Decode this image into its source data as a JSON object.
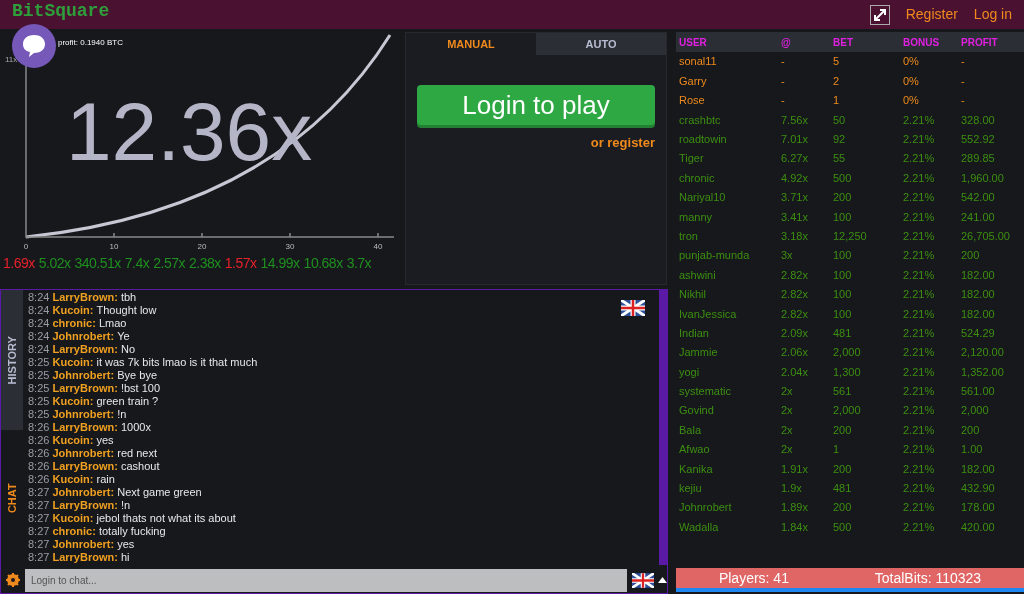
{
  "header": {
    "logo": "BitSquare",
    "links": [
      {
        "label": "Register"
      },
      {
        "label": "Log in"
      }
    ]
  },
  "game": {
    "profit_label": "profit: 0.1940 BTC",
    "y_tick": "11x",
    "x_ticks": [
      "0",
      "10",
      "20",
      "30",
      "40"
    ],
    "multiplier": "12.36x"
  },
  "history": [
    {
      "value": "1.69x",
      "color": "#e8202a"
    },
    {
      "value": "5.02x",
      "color": "#1f8f1f"
    },
    {
      "value": "340.51x",
      "color": "#1f8f1f"
    },
    {
      "value": "7.4x",
      "color": "#1f8f1f"
    },
    {
      "value": "2.57x",
      "color": "#1f8f1f"
    },
    {
      "value": "2.38x",
      "color": "#1f8f1f"
    },
    {
      "value": "1.57x",
      "color": "#e8202a"
    },
    {
      "value": "14.99x",
      "color": "#1f8f1f"
    },
    {
      "value": "10.68x",
      "color": "#1f8f1f"
    },
    {
      "value": "3.7x",
      "color": "#1f8f1f"
    }
  ],
  "controls": {
    "tabs": [
      {
        "label": "MANUAL",
        "selected": true
      },
      {
        "label": "AUTO",
        "selected": false
      }
    ],
    "play_button": "Login to play",
    "register_link": "or register"
  },
  "chat": {
    "side_tabs": [
      {
        "label": "HISTORY",
        "selected": false
      },
      {
        "label": "CHAT",
        "selected": true
      }
    ],
    "messages": [
      {
        "time": "8:24",
        "user": "LarryBrown:",
        "text": "tbh"
      },
      {
        "time": "8:24",
        "user": "Kucoin:",
        "text": "Thought low"
      },
      {
        "time": "8:24",
        "user": "chronic:",
        "text": "Lmao"
      },
      {
        "time": "8:24",
        "user": "Johnrobert:",
        "text": "Ye"
      },
      {
        "time": "8:24",
        "user": "LarryBrown:",
        "text": "No"
      },
      {
        "time": "8:25",
        "user": "Kucoin:",
        "text": "it was 7k bits lmao is it that much"
      },
      {
        "time": "8:25",
        "user": "Johnrobert:",
        "text": "Bye bye"
      },
      {
        "time": "8:25",
        "user": "LarryBrown:",
        "text": "!bst 100"
      },
      {
        "time": "8:25",
        "user": "Kucoin:",
        "text": "green train ?"
      },
      {
        "time": "8:25",
        "user": "Johnrobert:",
        "text": "!n"
      },
      {
        "time": "8:26",
        "user": "LarryBrown:",
        "text": "1000x"
      },
      {
        "time": "8:26",
        "user": "Kucoin:",
        "text": "yes"
      },
      {
        "time": "8:26",
        "user": "Johnrobert:",
        "text": "red next"
      },
      {
        "time": "8:26",
        "user": "LarryBrown:",
        "text": "cashout"
      },
      {
        "time": "8:26",
        "user": "Kucoin:",
        "text": "rain"
      },
      {
        "time": "8:27",
        "user": "Johnrobert:",
        "text": "Next game green"
      },
      {
        "time": "8:27",
        "user": "LarryBrown:",
        "text": "!n"
      },
      {
        "time": "8:27",
        "user": "Kucoin:",
        "text": "jebol thats not what its about"
      },
      {
        "time": "8:27",
        "user": "chronic:",
        "text": "totally fucking"
      },
      {
        "time": "8:27",
        "user": "Johnrobert:",
        "text": "yes"
      },
      {
        "time": "8:27",
        "user": "LarryBrown:",
        "text": "hi"
      }
    ],
    "input": {
      "placeholder": "Login to chat..."
    }
  },
  "players": {
    "columns": [
      "USER",
      "@",
      "BET",
      "BONUS",
      "PROFIT"
    ],
    "rows": [
      {
        "cells": [
          "sonal11",
          "-",
          "5",
          "0%",
          "-"
        ],
        "cashed_out": false
      },
      {
        "cells": [
          "Garry",
          "-",
          "2",
          "0%",
          "-"
        ],
        "cashed_out": false
      },
      {
        "cells": [
          "Rose",
          "-",
          "1",
          "0%",
          "-"
        ],
        "cashed_out": false
      },
      {
        "cells": [
          "crashbtc",
          "7.56x",
          "50",
          "2.21%",
          "328.00"
        ],
        "cashed_out": true
      },
      {
        "cells": [
          "roadtowin",
          "7.01x",
          "92",
          "2.21%",
          "552.92"
        ],
        "cashed_out": true
      },
      {
        "cells": [
          "Tiger",
          "6.27x",
          "55",
          "2.21%",
          "289.85"
        ],
        "cashed_out": true
      },
      {
        "cells": [
          "chronic",
          "4.92x",
          "500",
          "2.21%",
          "1,960.00"
        ],
        "cashed_out": true
      },
      {
        "cells": [
          "Nariyal10",
          "3.71x",
          "200",
          "2.21%",
          "542.00"
        ],
        "cashed_out": true
      },
      {
        "cells": [
          "manny",
          "3.41x",
          "100",
          "2.21%",
          "241.00"
        ],
        "cashed_out": true
      },
      {
        "cells": [
          "tron",
          "3.18x",
          "12,250",
          "2.21%",
          "26,705.00"
        ],
        "cashed_out": true
      },
      {
        "cells": [
          "punjab-munda",
          "3x",
          "100",
          "2.21%",
          "200"
        ],
        "cashed_out": true
      },
      {
        "cells": [
          "ashwini",
          "2.82x",
          "100",
          "2.21%",
          "182.00"
        ],
        "cashed_out": true
      },
      {
        "cells": [
          "Nikhil",
          "2.82x",
          "100",
          "2.21%",
          "182.00"
        ],
        "cashed_out": true
      },
      {
        "cells": [
          "IvanJessica",
          "2.82x",
          "100",
          "2.21%",
          "182.00"
        ],
        "cashed_out": true
      },
      {
        "cells": [
          "Indian",
          "2.09x",
          "481",
          "2.21%",
          "524.29"
        ],
        "cashed_out": true
      },
      {
        "cells": [
          "Jammie",
          "2.06x",
          "2,000",
          "2.21%",
          "2,120.00"
        ],
        "cashed_out": true
      },
      {
        "cells": [
          "yogi",
          "2.04x",
          "1,300",
          "2.21%",
          "1,352.00"
        ],
        "cashed_out": true
      },
      {
        "cells": [
          "systematic",
          "2x",
          "561",
          "2.21%",
          "561.00"
        ],
        "cashed_out": true
      },
      {
        "cells": [
          "Govind",
          "2x",
          "2,000",
          "2.21%",
          "2,000"
        ],
        "cashed_out": true
      },
      {
        "cells": [
          "Bala",
          "2x",
          "200",
          "2.21%",
          "200"
        ],
        "cashed_out": true
      },
      {
        "cells": [
          "Afwao",
          "2x",
          "1",
          "2.21%",
          "1.00"
        ],
        "cashed_out": true
      },
      {
        "cells": [
          "Kanika",
          "1.91x",
          "200",
          "2.21%",
          "182.00"
        ],
        "cashed_out": true
      },
      {
        "cells": [
          "kejiu",
          "1.9x",
          "481",
          "2.21%",
          "432.90"
        ],
        "cashed_out": true
      },
      {
        "cells": [
          "Johnrobert",
          "1.89x",
          "200",
          "2.21%",
          "178.00"
        ],
        "cashed_out": true
      },
      {
        "cells": [
          "Wadalla",
          "1.84x",
          "500",
          "2.21%",
          "420.00"
        ],
        "cashed_out": true
      }
    ],
    "footer": {
      "players": "Players: 41",
      "total": "TotalBits: 110323"
    }
  }
}
